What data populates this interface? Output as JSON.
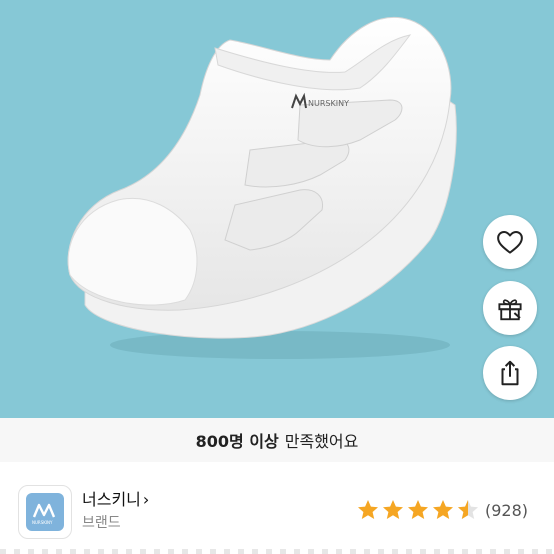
{
  "product_image": {
    "alt": "white nurse slip-on shoe",
    "logo_text": "NURSKINY"
  },
  "actions": {
    "like_icon": "heart-icon",
    "gift_icon": "gift-icon",
    "share_icon": "share-icon"
  },
  "satisfaction": {
    "count": "800명 이상",
    "text": "만족했어요"
  },
  "brand": {
    "name": "너스키니",
    "chevron": "›",
    "label": "브랜드",
    "logo_text": "NURSKINY"
  },
  "rating": {
    "value": 4.5,
    "max": 5,
    "reviews": "(928)",
    "star_color": "#f5a623"
  },
  "colors": {
    "hero_bg": "#86c8d6"
  }
}
